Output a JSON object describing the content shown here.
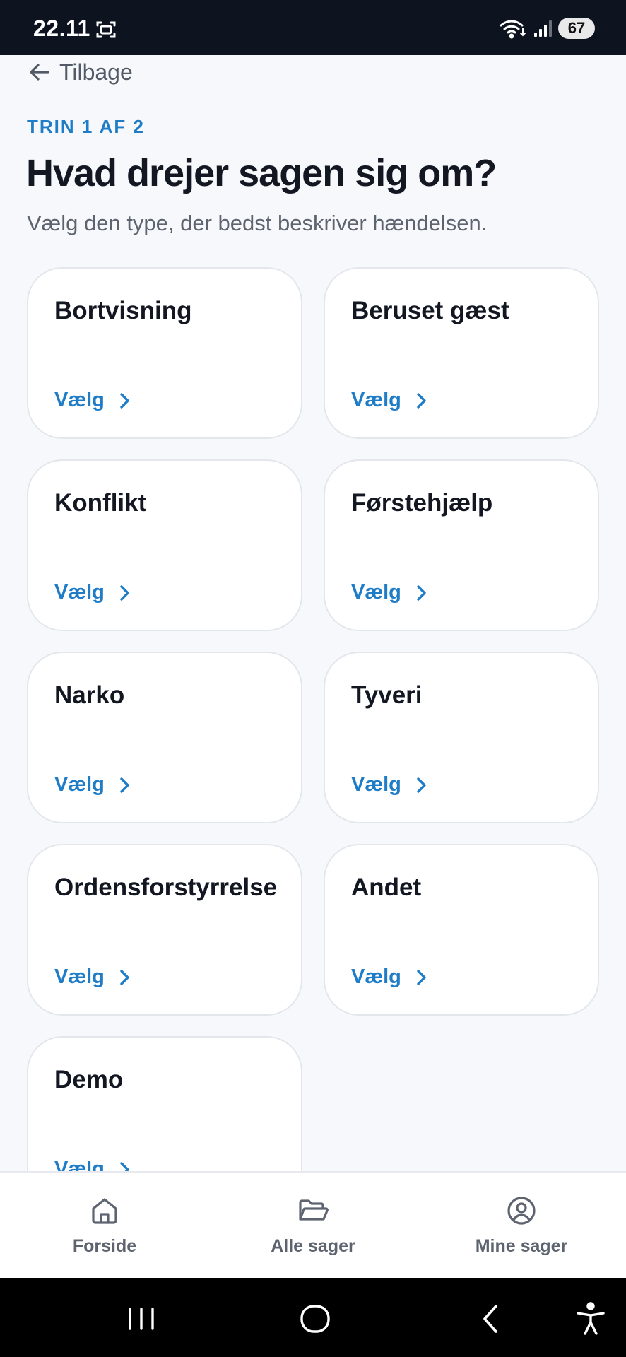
{
  "status_bar": {
    "time": "22.11",
    "battery": "67",
    "icons": [
      "screenshot-icon",
      "wifi-icon",
      "signal-icon",
      "battery-icon"
    ]
  },
  "back": {
    "label": "Tilbage",
    "icon": "arrow-left-icon"
  },
  "step": "TRIN 1 AF 2",
  "title": "Hvad drejer sagen sig om?",
  "subtitle": "Vælg den type, der bedst beskriver hændelsen.",
  "choose_label": "Vælg",
  "cards": [
    {
      "title": "Bortvisning",
      "choose": "Vælg"
    },
    {
      "title": "Beruset gæst",
      "choose": "Vælg"
    },
    {
      "title": "Konflikt",
      "choose": "Vælg"
    },
    {
      "title": "Førstehjælp",
      "choose": "Vælg"
    },
    {
      "title": "Narko",
      "choose": "Vælg"
    },
    {
      "title": "Tyveri",
      "choose": "Vælg"
    },
    {
      "title": "Ordensforstyrrelse",
      "choose": "Vælg"
    },
    {
      "title": "Andet",
      "choose": "Vælg"
    },
    {
      "title": "Demo",
      "choose": "Vælg"
    }
  ],
  "bottom_nav": [
    {
      "label": "Forside",
      "icon": "home-icon"
    },
    {
      "label": "Alle sager",
      "icon": "folder-open-icon"
    },
    {
      "label": "Mine sager",
      "icon": "user-circle-icon"
    }
  ],
  "system_nav": [
    "recent-apps-icon",
    "home-circle-icon",
    "back-chevron-icon",
    "accessibility-icon"
  ],
  "colors": {
    "accent": "#1f7cc7",
    "title": "#121722",
    "muted": "#5d6470",
    "background": "#f6f8fb",
    "status_bar": "#0e1320"
  }
}
